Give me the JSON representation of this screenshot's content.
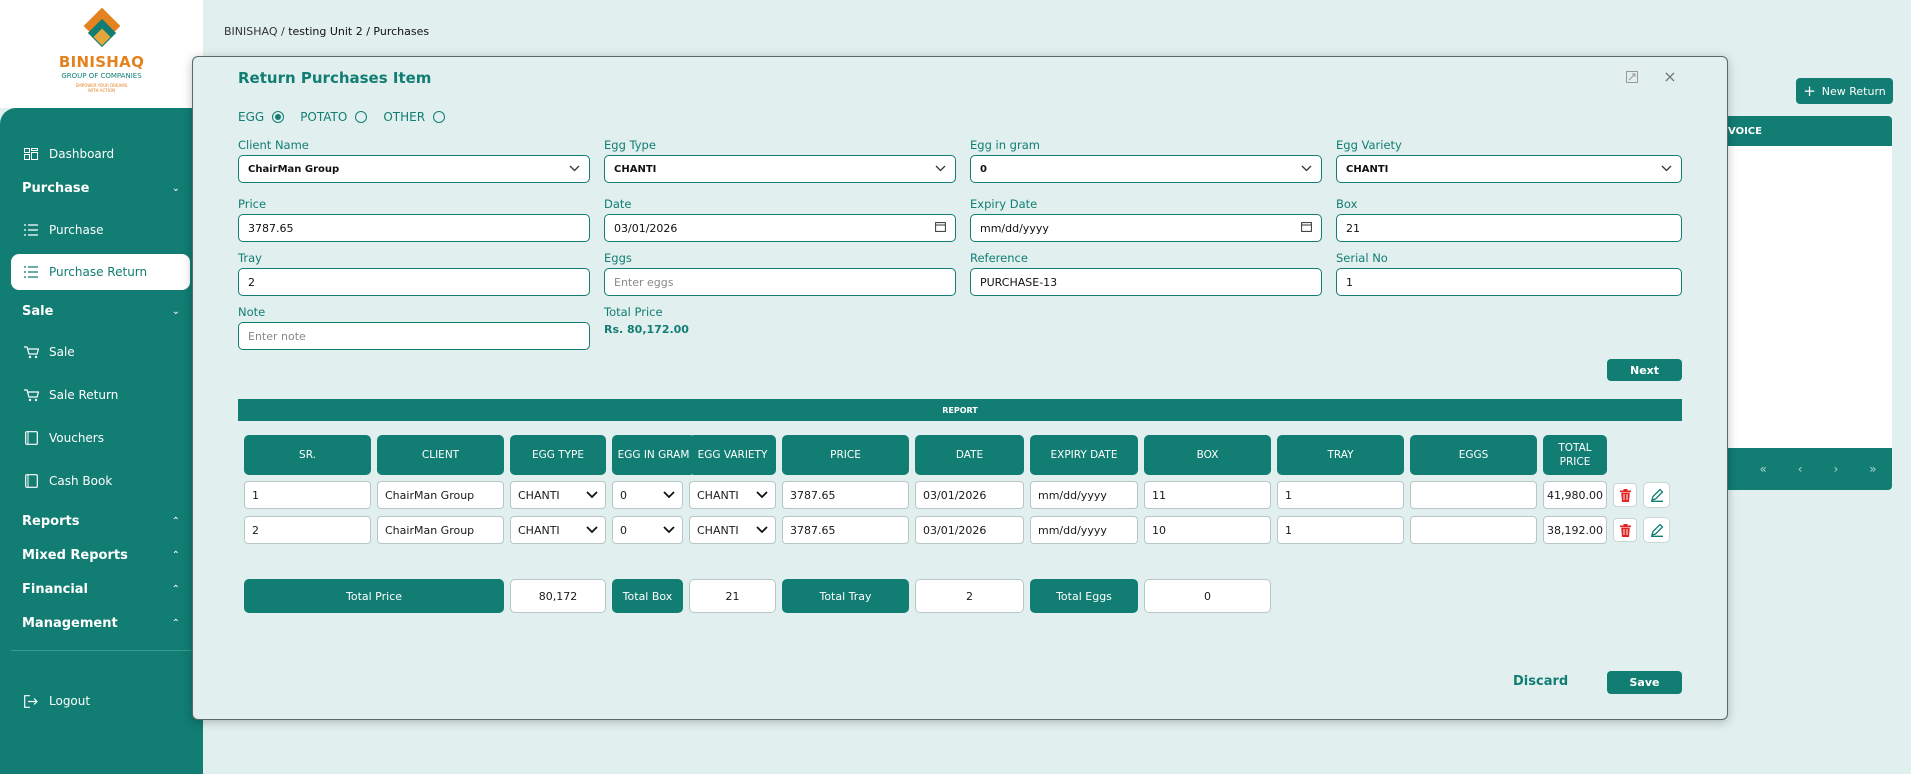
{
  "breadcrumb": {
    "root": "BINISHAQ / ",
    "current": "testing Unit 2 / Purchases"
  },
  "logo": {
    "name": "BINISHAQ",
    "sub": "GROUP OF COMPANIES",
    "tagline": "EMPOWER YOUR DREAMS WITH ACTION"
  },
  "sidebar": {
    "dashboard": "Dashboard",
    "purchase_section": "Purchase",
    "purchase": "Purchase",
    "purchase_return": "Purchase Return",
    "sale_section": "Sale",
    "sale": "Sale",
    "sale_return": "Sale Return",
    "vouchers": "Vouchers",
    "cash_book": "Cash Book",
    "reports": "Reports",
    "mixed_reports": "Mixed Reports",
    "financial": "Financial",
    "management": "Management",
    "logout": "Logout"
  },
  "page": {
    "new_return": "New Return",
    "invoice_header": "VOICE"
  },
  "modal": {
    "title": "Return Purchases Item",
    "radios": [
      {
        "label": "EGG",
        "checked": true
      },
      {
        "label": "POTATO",
        "checked": false
      },
      {
        "label": "OTHER",
        "checked": false
      }
    ],
    "fields": {
      "client_name": {
        "label": "Client Name",
        "value": "ChairMan Group"
      },
      "egg_type": {
        "label": "Egg Type",
        "value": "CHANTI"
      },
      "egg_gram": {
        "label": "Egg in gram",
        "value": "0"
      },
      "egg_variety": {
        "label": "Egg Variety",
        "value": "CHANTI"
      },
      "price": {
        "label": "Price",
        "value": "3787.65"
      },
      "date": {
        "label": "Date",
        "value": "03/01/2026"
      },
      "expiry": {
        "label": "Expiry Date",
        "value": "mm/dd/yyyy"
      },
      "box": {
        "label": "Box",
        "value": "21"
      },
      "tray": {
        "label": "Tray",
        "value": "2"
      },
      "eggs": {
        "label": "Eggs",
        "placeholder": "Enter eggs"
      },
      "reference": {
        "label": "Reference",
        "value": "PURCHASE-13"
      },
      "serial": {
        "label": "Serial No",
        "value": "1"
      },
      "note": {
        "label": "Note",
        "placeholder": "Enter note"
      },
      "total_price": {
        "label": "Total Price",
        "value": "Rs. 80,172.00"
      }
    },
    "next": "Next",
    "report_title": "REPORT",
    "columns": [
      "SR.",
      "CLIENT",
      "EGG TYPE",
      "EGG IN GRAM",
      "EGG VARIETY",
      "PRICE",
      "DATE",
      "EXPIRY DATE",
      "BOX",
      "TRAY",
      "EGGS",
      "TOTAL PRICE"
    ],
    "rows": [
      {
        "sr": "1",
        "client": "ChairMan Group",
        "egg_type": "CHANTI",
        "gram": "0",
        "variety": "CHANTI",
        "price": "3787.65",
        "date": "03/01/2026",
        "expiry": "mm/dd/yyyy",
        "box": "11",
        "tray": "1",
        "eggs": "",
        "total": "41,980.00"
      },
      {
        "sr": "2",
        "client": "ChairMan Group",
        "egg_type": "CHANTI",
        "gram": "0",
        "variety": "CHANTI",
        "price": "3787.65",
        "date": "03/01/2026",
        "expiry": "mm/dd/yyyy",
        "box": "10",
        "tray": "1",
        "eggs": "",
        "total": "38,192.00"
      }
    ],
    "totals": {
      "price_label": "Total Price",
      "price_value": "80,172",
      "box_label": "Total Box",
      "box_value": "21",
      "tray_label": "Total Tray",
      "tray_value": "2",
      "eggs_label": "Total Eggs",
      "eggs_value": "0"
    },
    "discard": "Discard",
    "save": "Save"
  },
  "colors": {
    "primary": "#117d73",
    "background": "#e1f0ee",
    "accent_orange": "#e4821f",
    "delete_red": "#e02424"
  }
}
